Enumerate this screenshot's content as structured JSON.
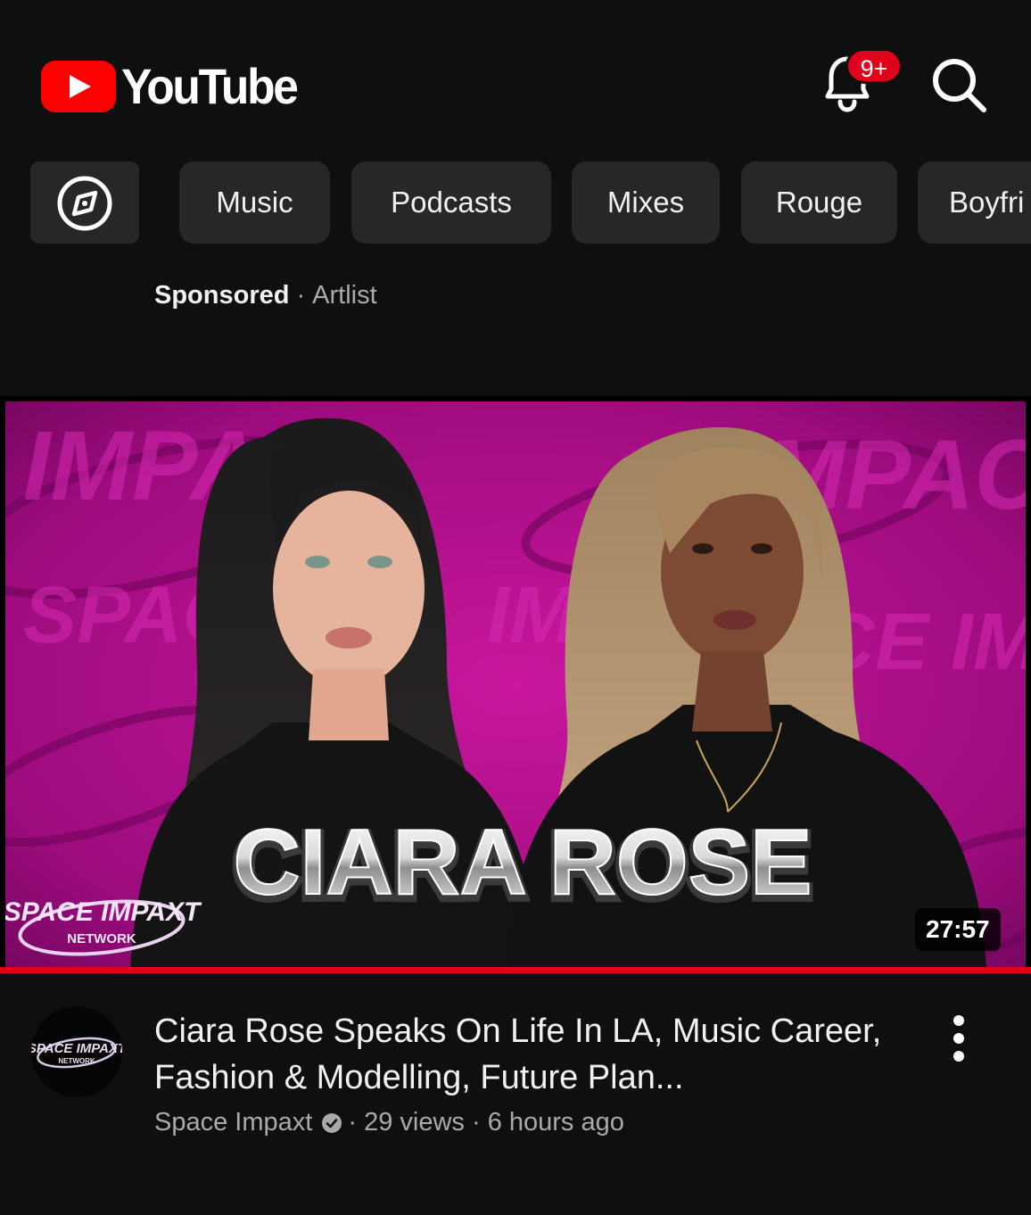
{
  "app": {
    "name": "YouTube"
  },
  "header": {
    "logo_text": "YouTube",
    "notification_badge": "9+"
  },
  "chips": [
    {
      "label": "Music"
    },
    {
      "label": "Podcasts"
    },
    {
      "label": "Mixes"
    },
    {
      "label": "Rouge"
    },
    {
      "label": "Boyfri"
    }
  ],
  "ad": {
    "sponsored_label": "Sponsored",
    "separator": "·",
    "advertiser": "Artlist"
  },
  "video": {
    "thumbnail_text": "CIARA ROSE",
    "thumbnail_logo_line1": "SPACE IMPAXT",
    "thumbnail_logo_line2": "NETWORK",
    "duration": "27:57",
    "title": "Ciara Rose Speaks On Life In LA, Music Career, Fashion & Modelling, Future Plan...",
    "channel": "Space Impaxt",
    "views": "29 views",
    "age": "6 hours ago",
    "meta_separator": "·",
    "watch_progress": 1.0
  },
  "colors": {
    "background": "#0f0f0f",
    "chip": "#272727",
    "brand_red": "#ff0000",
    "progress": "#e1001c",
    "thumbnail_magenta": "#b0108e"
  }
}
